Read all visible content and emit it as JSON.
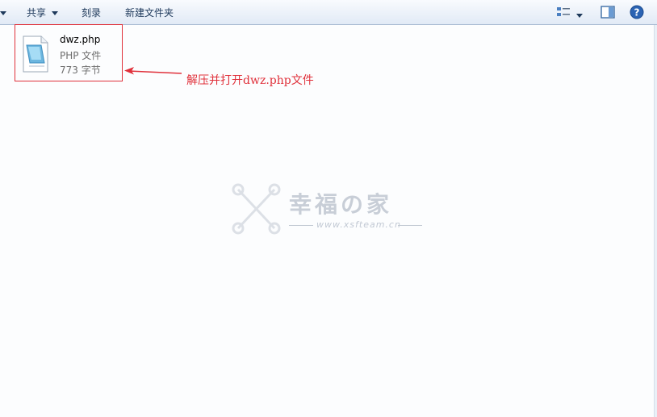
{
  "toolbar": {
    "share_label": "共享",
    "burn_label": "刻录",
    "new_folder_label": "新建文件夹"
  },
  "file": {
    "name": "dwz.php",
    "type": "PHP 文件",
    "size": "773 字节"
  },
  "annotation": {
    "text": "解压并打开dwz.php文件",
    "color": "#e0313b"
  },
  "watermark": {
    "title": "幸福の家",
    "url": "www.xsfteam.cn"
  }
}
